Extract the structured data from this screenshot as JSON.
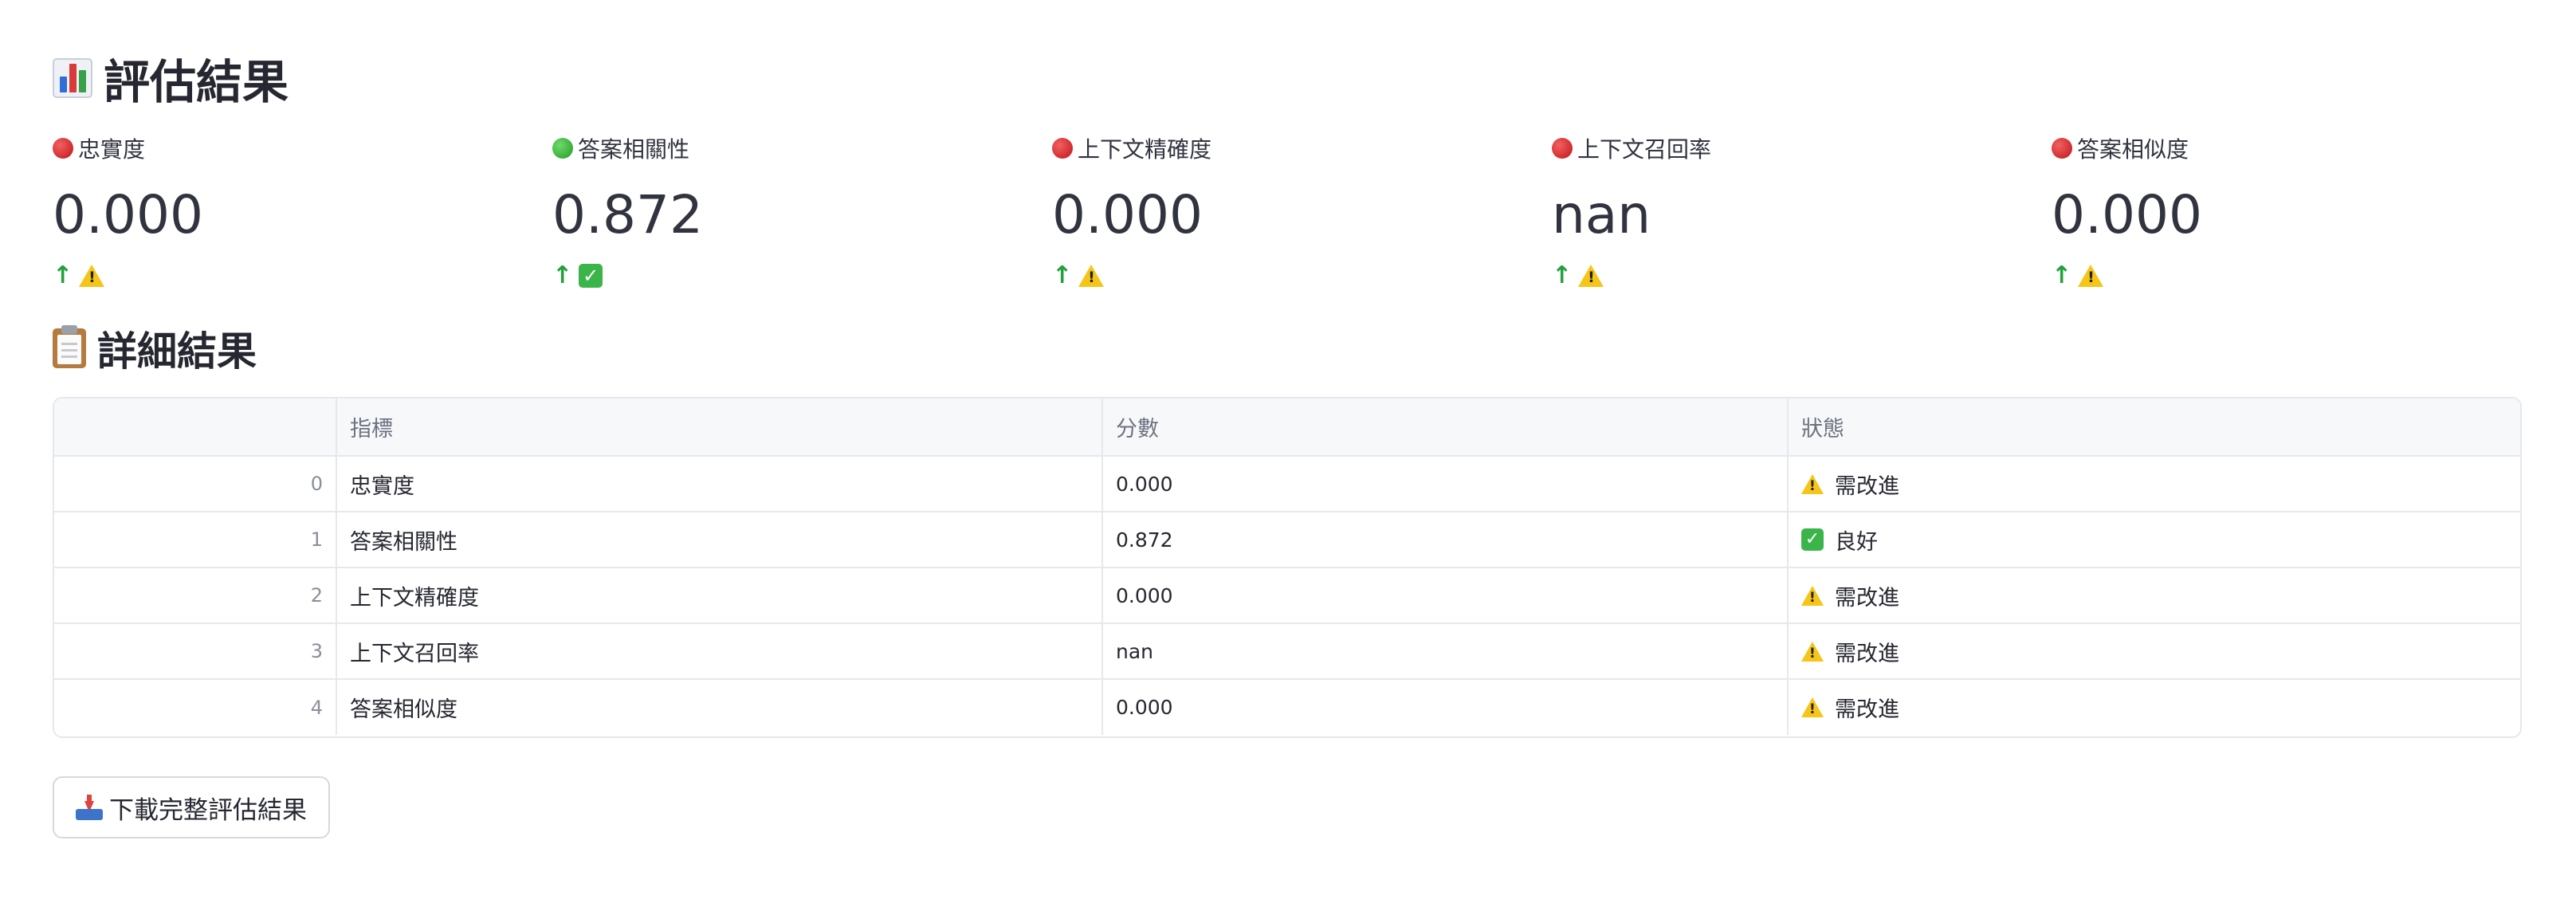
{
  "header": {
    "title": "評估結果",
    "icon": "bar-chart-icon"
  },
  "metrics": [
    {
      "label": "忠實度",
      "value": "0.000",
      "indicator": "red",
      "delta_arrow": "↑",
      "delta_icon": "warning-icon"
    },
    {
      "label": "答案相關性",
      "value": "0.872",
      "indicator": "green",
      "delta_arrow": "↑",
      "delta_icon": "check-icon"
    },
    {
      "label": "上下文精確度",
      "value": "0.000",
      "indicator": "red",
      "delta_arrow": "↑",
      "delta_icon": "warning-icon"
    },
    {
      "label": "上下文召回率",
      "value": "nan",
      "indicator": "red",
      "delta_arrow": "↑",
      "delta_icon": "warning-icon"
    },
    {
      "label": "答案相似度",
      "value": "0.000",
      "indicator": "red",
      "delta_arrow": "↑",
      "delta_icon": "warning-icon"
    }
  ],
  "details": {
    "title": "詳細結果",
    "icon": "clipboard-icon",
    "columns": [
      "",
      "指標",
      "分數",
      "狀態"
    ],
    "rows": [
      {
        "index": "0",
        "metric": "忠實度",
        "score": "0.000",
        "status": "需改進",
        "status_icon": "warning-icon"
      },
      {
        "index": "1",
        "metric": "答案相關性",
        "score": "0.872",
        "status": "良好",
        "status_icon": "check-icon"
      },
      {
        "index": "2",
        "metric": "上下文精確度",
        "score": "0.000",
        "status": "需改進",
        "status_icon": "warning-icon"
      },
      {
        "index": "3",
        "metric": "上下文召回率",
        "score": "nan",
        "status": "需改進",
        "status_icon": "warning-icon"
      },
      {
        "index": "4",
        "metric": "答案相似度",
        "score": "0.000",
        "status": "需改進",
        "status_icon": "warning-icon"
      }
    ]
  },
  "download": {
    "label": "下載完整評估結果",
    "icon": "inbox-tray-icon"
  },
  "colors": {
    "red_indicator": "#c0141a",
    "green_indicator": "#239b24",
    "delta_arrow": "#21a13b",
    "warning": "#f5c518",
    "check": "#3bb54a"
  }
}
